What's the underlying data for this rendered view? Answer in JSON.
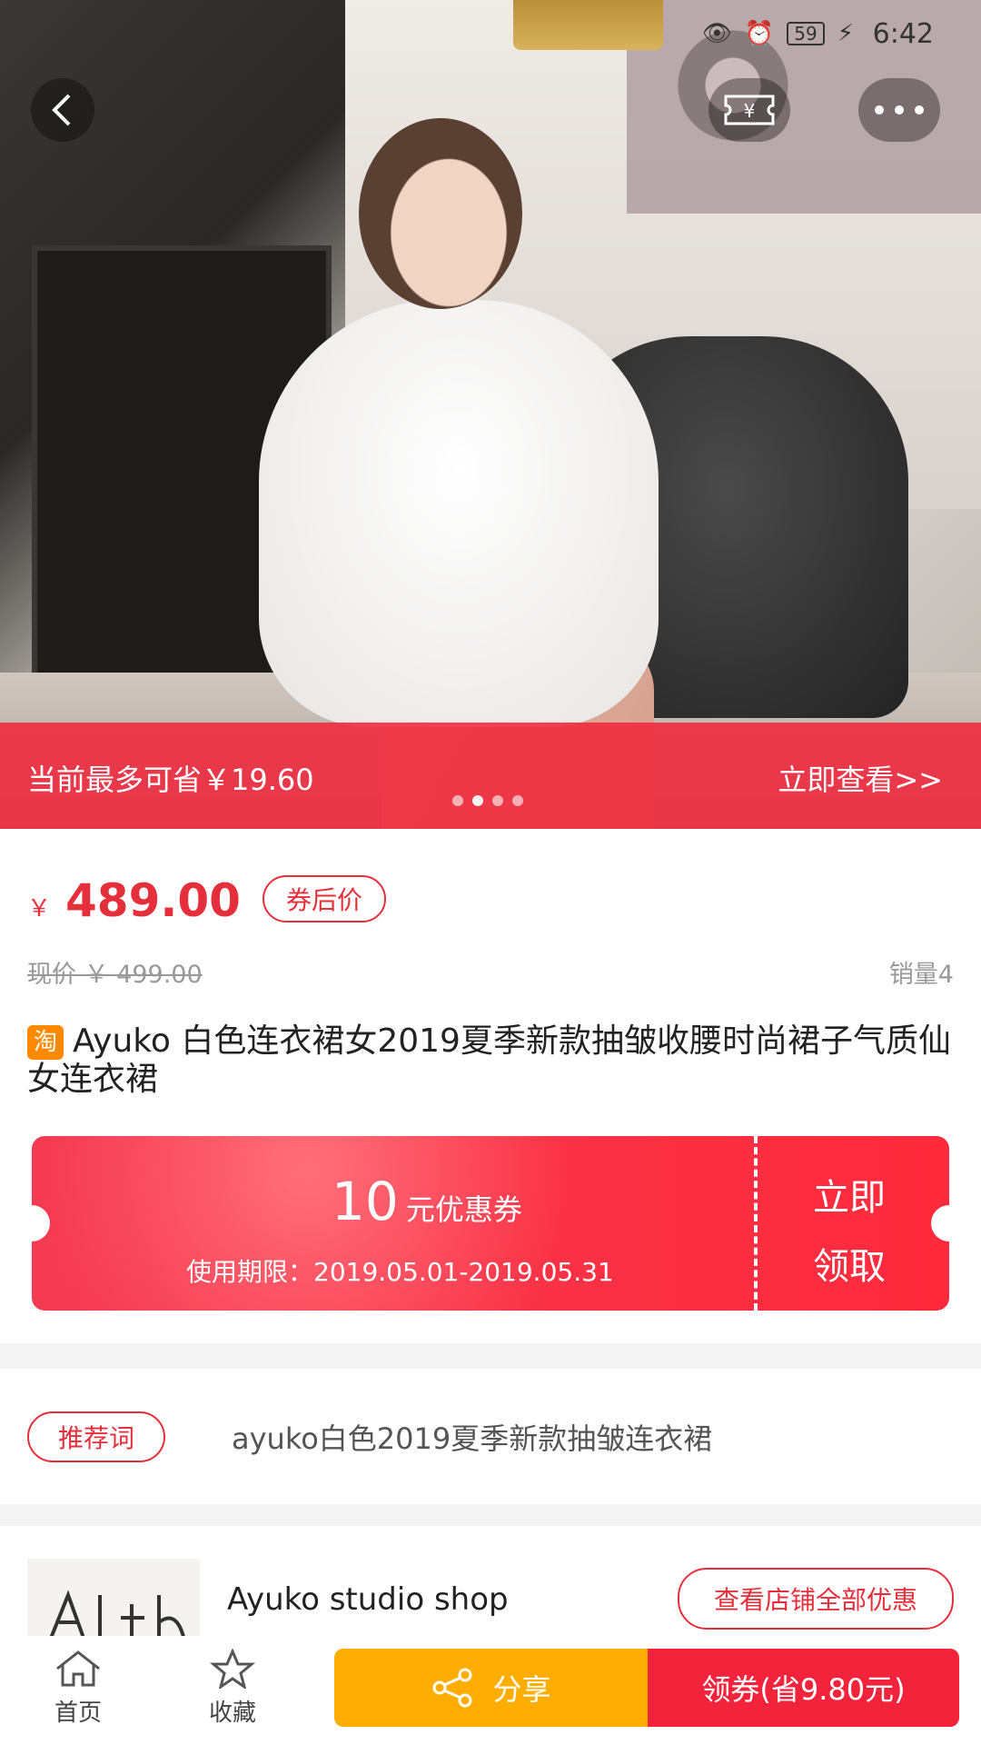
{
  "status": {
    "time": "6:42",
    "battery": "59"
  },
  "hero": {
    "save_text": "当前最多可省￥19.60",
    "save_link": "立即查看>>",
    "carousel_count": 4,
    "carousel_active": 1
  },
  "price": {
    "currency": "￥",
    "value": "489.00",
    "badge": "券后价",
    "original": "现价 ￥ 499.00",
    "sales": "销量4"
  },
  "product": {
    "platform_icon": "淘",
    "title": "Ayuko 白色连衣裙女2019夏季新款抽皱收腰时尚裙子气质仙女连衣裙"
  },
  "coupon": {
    "amount": "10",
    "unit": "元优惠券",
    "period": "使用期限：2019.05.01-2019.05.31",
    "cta_line1": "立即",
    "cta_line2": "领取"
  },
  "recommend": {
    "tag": "推荐词",
    "text": "ayuko白色2019夏季新款抽皱连衣裙"
  },
  "shop": {
    "name": "Ayuko studio shop",
    "all_deals_label": "查看店铺全部优惠"
  },
  "bottom_nav": {
    "home_label": "首页",
    "fav_label": "收藏",
    "share_label": "分享",
    "claim_label": "领券(省9.80元)"
  },
  "colors": {
    "accent": "#e5303b",
    "share": "#ffae00",
    "claim": "#f2233a"
  }
}
